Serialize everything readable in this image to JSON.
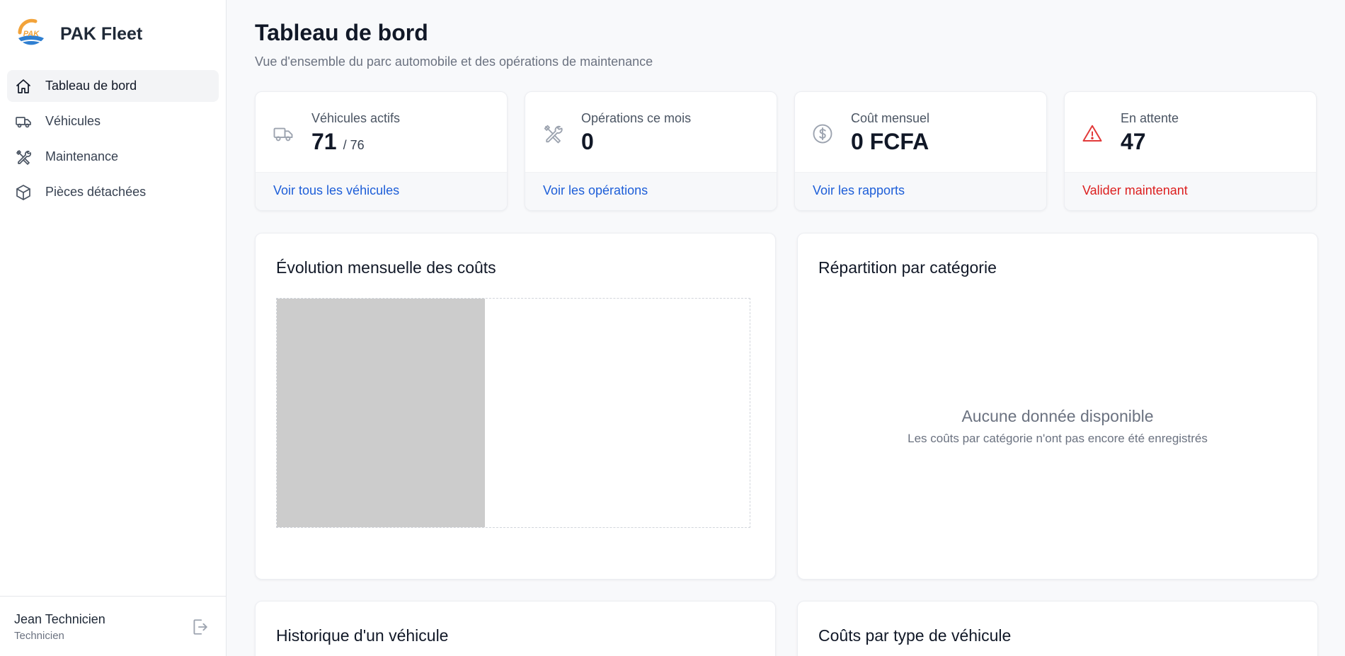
{
  "brand": {
    "logo_text": "PAK",
    "name": "PAK Fleet"
  },
  "sidebar": {
    "items": [
      {
        "label": "Tableau de bord",
        "icon": "home-icon",
        "active": true
      },
      {
        "label": "Véhicules",
        "icon": "truck-icon",
        "active": false
      },
      {
        "label": "Maintenance",
        "icon": "tools-icon",
        "active": false
      },
      {
        "label": "Pièces détachées",
        "icon": "box-icon",
        "active": false
      }
    ],
    "user": {
      "name": "Jean Technicien",
      "role": "Technicien"
    },
    "logout_icon": "logout-icon"
  },
  "header": {
    "title": "Tableau de bord",
    "subtitle": "Vue d'ensemble du parc automobile et des opérations de maintenance"
  },
  "stats": [
    {
      "label": "Véhicules actifs",
      "value": "71",
      "suffix": "/ 76",
      "link": "Voir tous les véhicules",
      "icon": "truck-icon",
      "tone": "default"
    },
    {
      "label": "Opérations ce mois",
      "value": "0",
      "suffix": "",
      "link": "Voir les opérations",
      "icon": "tools-icon",
      "tone": "default"
    },
    {
      "label": "Coût mensuel",
      "value": "0 FCFA",
      "suffix": "",
      "link": "Voir les rapports",
      "icon": "dollar-icon",
      "tone": "default"
    },
    {
      "label": "En attente",
      "value": "47",
      "suffix": "",
      "link": "Valider maintenant",
      "icon": "alert-icon",
      "tone": "danger"
    }
  ],
  "panels": {
    "cost_evolution": {
      "title": "Évolution mensuelle des coûts"
    },
    "category_split": {
      "title": "Répartition par catégorie",
      "empty_title": "Aucune donnée disponible",
      "empty_text": "Les coûts par catégorie n'ont pas encore été enregistrés"
    },
    "vehicle_history": {
      "title": "Historique d'un véhicule"
    },
    "vehicle_type_costs": {
      "title": "Coûts par type de véhicule"
    }
  },
  "colors": {
    "link": "#1d5ed8",
    "danger": "#dc1f1f",
    "logo_orange": "#f2a33a",
    "logo_blue": "#2f7fd1"
  }
}
